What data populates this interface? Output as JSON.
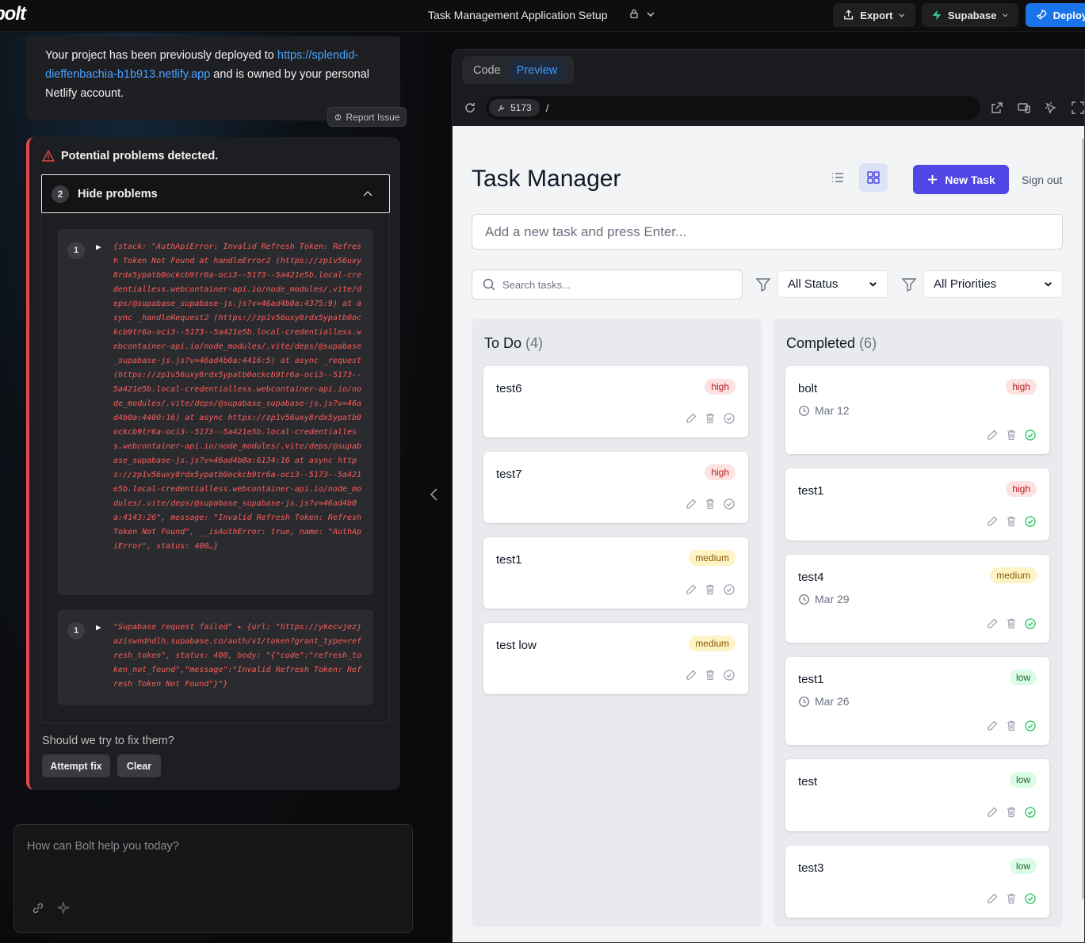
{
  "topbar": {
    "logo": "bolt",
    "project_title": "Task Management Application Setup",
    "export_label": "Export",
    "supabase_label": "Supabase",
    "deploy_label": "Deploy"
  },
  "chat": {
    "deploy_msg_pre": "Your project has been previously deployed to ",
    "deploy_msg_link": "https://splendid-dieffenbachia-b1b913.netlify.app",
    "deploy_msg_post": " and is owned by your personal Netlify account.",
    "report_issue": "Report Issue",
    "problems_title": "Potential problems detected.",
    "problems_count": "2",
    "hide_problems": "Hide problems",
    "error1_count": "1",
    "error1_text": "{stack: \"AuthApiError: Invalid Refresh Token: Refresh Token Not Found at handleError2 (https://zp1v56uxy8rdx5ypatb0ockcb9tr6a-oci3--5173--5a421e5b.local-credentialless.webcontainer-api.io/node_modules/.vite/deps/@supabase_supabase-js.js?v=46ad4b0a:4375:9) at async _handleRequest2 (https://zp1v56uxy8rdx5ypatb0ockcb9tr6a-oci3--5173--5a421e5b.local-credentialless.webcontainer-api.io/node_modules/.vite/deps/@supabase_supabase-js.js?v=46ad4b0a:4416:5) at async _request (https://zp1v56uxy8rdx5ypatb0ockcb9tr6a-oci3--5173--5a421e5b.local-credentialless.webcontainer-api.io/node_modules/.vite/deps/@supabase_supabase-js.js?v=46ad4b0a:4400:16) at async https://zp1v56uxy8rdx5ypatb0ockcb9tr6a-oci3--5173--5a421e5b.local-credentialless.webcontainer-api.io/node_modules/.vite/deps/@supabase_supabase-js.js?v=46ad4b0a:6134:16 at async https://zp1v56uxy8rdx5ypatb0ockcb9tr6a-oci3--5173--5a421e5b.local-credentialless.webcontainer-api.io/node_modules/.vite/deps/@supabase_supabase-js.js?v=46ad4b0a:4143:26\", message: \"Invalid Refresh Token: Refresh Token Not Found\", __isAuthError: true, name: \"AuthApiError\", status: 400…}",
    "error2_count": "1",
    "error2_text": "\"Supabase request failed\" ▸ {url: \"https://ykecvjezjaziswndndlh.supabase.co/auth/v1/token?grant_type=refresh_token\", status: 400, body: \"{\"code\":\"refresh_token_not_found\",\"message\":\"Invalid Refresh Token: Refresh Token Not Found\"}\"}",
    "fix_question": "Should we try to fix them?",
    "attempt_fix": "Attempt fix",
    "clear": "Clear",
    "input_placeholder": "How can Bolt help you today?"
  },
  "preview": {
    "tab_code": "Code",
    "tab_preview": "Preview",
    "port": "5173",
    "path": "/"
  },
  "app": {
    "title": "Task Manager",
    "new_task": "New Task",
    "sign_out": "Sign out",
    "add_placeholder": "Add a new task and press Enter...",
    "search_placeholder": "Search tasks...",
    "status_filter": "All Status",
    "priority_filter": "All Priorities",
    "todo": {
      "title": "To Do",
      "count": "(4)",
      "cards": [
        {
          "title": "test6",
          "priority": "high"
        },
        {
          "title": "test7",
          "priority": "high"
        },
        {
          "title": "test1",
          "priority": "medium"
        },
        {
          "title": "test low",
          "priority": "medium"
        }
      ]
    },
    "completed": {
      "title": "Completed",
      "count": "(6)",
      "cards": [
        {
          "title": "bolt",
          "priority": "high",
          "date": "Mar 12"
        },
        {
          "title": "test1",
          "priority": "high"
        },
        {
          "title": "test4",
          "priority": "medium",
          "date": "Mar 29"
        },
        {
          "title": "test1",
          "priority": "low",
          "date": "Mar 26"
        },
        {
          "title": "test",
          "priority": "low"
        },
        {
          "title": "test3",
          "priority": "low"
        }
      ]
    }
  },
  "colors": {
    "accent": "#4f46e5",
    "deploy": "#1a73e8",
    "error": "#e5484d",
    "link": "#4aa3ff"
  }
}
